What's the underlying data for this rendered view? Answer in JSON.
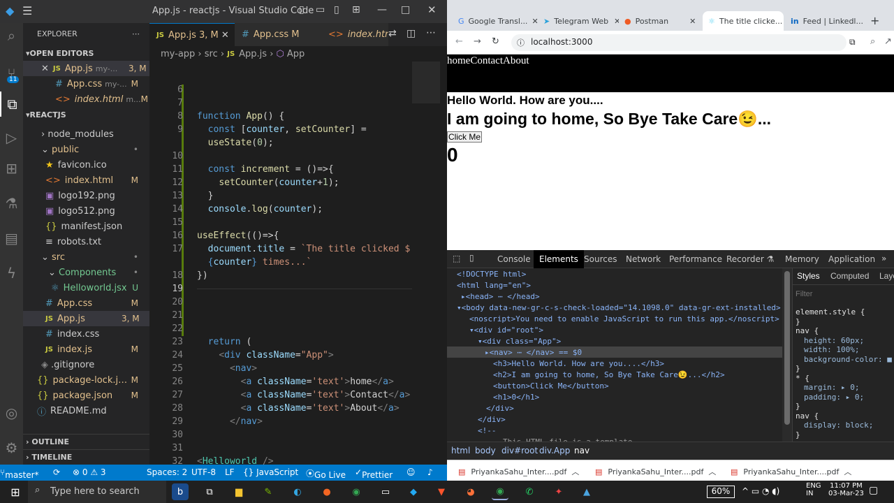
{
  "vscode": {
    "title": "App.js - reactjs - Visual Studio Code",
    "explorer_label": "EXPLORER",
    "open_editors_label": "OPEN EDITORS",
    "open_editors": [
      {
        "name": "App.js",
        "extra": "my-...",
        "status": "3, M",
        "icon": "JS"
      },
      {
        "name": "App.css",
        "extra": "my-...",
        "status": "M",
        "icon": "#"
      },
      {
        "name": "index.html",
        "extra": "m...",
        "status": "M",
        "icon": "<>"
      }
    ],
    "project_label": "REACTJS",
    "tree": [
      {
        "name": "node_modules",
        "status": ""
      },
      {
        "name": "public",
        "status": "•"
      },
      {
        "name": "favicon.ico",
        "status": ""
      },
      {
        "name": "index.html",
        "status": "M"
      },
      {
        "name": "logo192.png",
        "status": ""
      },
      {
        "name": "logo512.png",
        "status": ""
      },
      {
        "name": "manifest.json",
        "status": ""
      },
      {
        "name": "robots.txt",
        "status": ""
      },
      {
        "name": "src",
        "status": "•"
      },
      {
        "name": "Components",
        "status": "•"
      },
      {
        "name": "Helloworld.jsx",
        "status": "U"
      },
      {
        "name": "App.css",
        "status": "M"
      },
      {
        "name": "App.js",
        "status": "3, M"
      },
      {
        "name": "index.css",
        "status": ""
      },
      {
        "name": "index.js",
        "status": "M"
      },
      {
        "name": ".gitignore",
        "status": ""
      },
      {
        "name": "package-lock.json",
        "status": "M"
      },
      {
        "name": "package.json",
        "status": "M"
      },
      {
        "name": "README.md",
        "status": ""
      }
    ],
    "outline_label": "OUTLINE",
    "timeline_label": "TIMELINE",
    "tabs": [
      {
        "label": "App.js",
        "status": "3, M"
      },
      {
        "label": "App.css",
        "status": "M"
      },
      {
        "label": "index.html",
        "status": ""
      }
    ],
    "breadcrumb": [
      "my-app",
      "src",
      "App.js",
      "App"
    ],
    "line_numbers": [
      "6",
      "7",
      "8",
      "9",
      "",
      "10",
      "11",
      "12",
      "13",
      "14",
      "15",
      "16",
      "17",
      "",
      "18",
      "19",
      "20",
      "21",
      "22",
      "23",
      "24",
      "25",
      "26",
      "27",
      "28",
      "29",
      "30",
      "31",
      "32",
      "33"
    ],
    "status": {
      "branch": "master*",
      "problems": "⊗ 0 ⚠ 3",
      "spaces": "Spaces: 2",
      "encoding": "UTF-8",
      "eol": "LF",
      "language": "{} JavaScript",
      "golive": "Go Live",
      "prettier": "Prettier"
    }
  },
  "browser": {
    "tabs": [
      "Google Transl...",
      "Telegram Web",
      "Postman",
      "The title clicke...",
      "Feed | Linkedl..."
    ],
    "url": "localhost:3000",
    "nav_links": [
      "home",
      "Contact",
      "About"
    ],
    "h3": "Hello World. How are you....",
    "h2": "I am going to home, So Bye Take Care😉...",
    "button": "Click Me",
    "h1": "0",
    "devtools_tabs": [
      "Console",
      "Elements",
      "Sources",
      "Network",
      "Performance",
      "Recorder",
      "Memory",
      "Application"
    ],
    "styles_tabs": [
      "Styles",
      "Computed",
      "Layo"
    ],
    "filter_placeholder": "Filter",
    "dom_lines": [
      "<!DOCTYPE html>",
      "<html lang=\"en\">",
      "▸<head> ⋯ </head>",
      "▾<body data-new-gr-c-s-check-loaded=\"14.1098.0\" data-gr-ext-installed>",
      "<noscript>You need to enable JavaScript to run this app.</noscript>",
      "▾<div id=\"root\">",
      "▾<div class=\"App\">",
      "▸<nav> ⋯ </nav> == $0",
      "<h3>Hello World. How are you....</h3>",
      "<h2>I am going to home, So Bye Take Care😉...</h2>",
      "<button>Click Me</button>",
      "<h1>0</h1>",
      "</div>",
      "</div>",
      "<!--",
      "This HTML file is a template"
    ],
    "styles_lines": [
      "element.style {",
      "}",
      "nav {",
      "height: 60px;",
      "width: 100%;",
      "background-color: ■",
      "}",
      "* {",
      "margin: ▸ 0;",
      "padding: ▸ 0;",
      "}",
      "nav {",
      "display: block;",
      "}"
    ],
    "dt_crumbs": [
      "html",
      "body",
      "div#root",
      "div.App",
      "nav"
    ],
    "downloads": [
      "PriyankaSahu_Inter....pdf",
      "PriyankaSahu_Inter....pdf",
      "PriyankaSahu_Inter....pdf"
    ]
  },
  "taskbar": {
    "search_placeholder": "Type here to search",
    "battery": "60%",
    "lang1": "ENG",
    "lang2": "IN",
    "time": "11:07 PM",
    "date": "03-Mar-23"
  }
}
